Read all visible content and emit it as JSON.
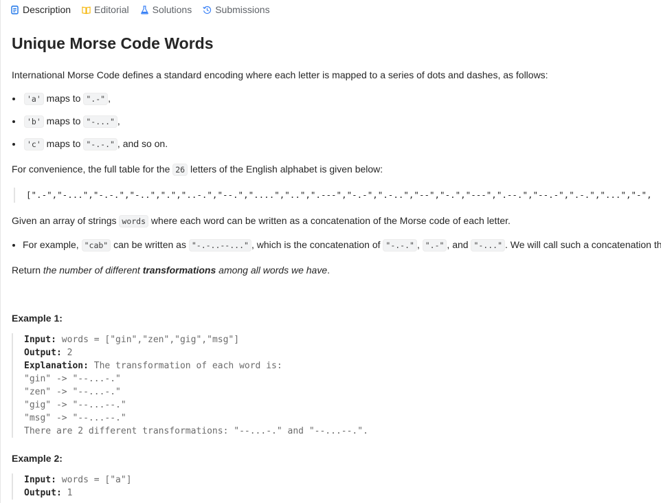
{
  "tabs": [
    {
      "label": "Description",
      "icon": "description-icon",
      "color": "#1a73e8"
    },
    {
      "label": "Editorial",
      "icon": "book-icon",
      "color": "#f5b400"
    },
    {
      "label": "Solutions",
      "icon": "flask-icon",
      "color": "#3b82f6"
    },
    {
      "label": "Submissions",
      "icon": "history-icon",
      "color": "#3b82f6"
    }
  ],
  "problem": {
    "title": "Unique Morse Code Words",
    "intro": "International Morse Code defines a standard encoding where each letter is mapped to a series of dots and dashes, as follows:",
    "mappings": [
      {
        "letter": "'a'",
        "mid": " maps to ",
        "code": "\".-\"",
        "tail": ","
      },
      {
        "letter": "'b'",
        "mid": " maps to ",
        "code": "\"-...\"",
        "tail": ","
      },
      {
        "letter": "'c'",
        "mid": " maps to ",
        "code": "\"-.-.\"",
        "tail": ", and so on."
      }
    ],
    "convenience_pre": "For convenience, the full table for the ",
    "convenience_num": "26",
    "convenience_post": " letters of the English alphabet is given below:",
    "table": "[\".-\",\"-...\",\"-.-.\",\"-..\",\".\",\"..-.\",\"--.\",\"....\",\"..\",\".---\",\"-.-\",\".-..\",\"--\",\"-.\",\"---\",\".--.\",\"--.-\",\".-.\",\"...\",\"-\",\"..-\",\"...-\",\".--\",\"-..-\",\"-.--\",\"--..\"]",
    "words_pre": "Given an array of strings ",
    "words_code": "words",
    "words_post": " where each word can be written as a concatenation of the Morse code of each letter.",
    "example_bullet": {
      "pre": "For example, ",
      "cab": "\"cab\"",
      "mid1": " can be written as ",
      "full": "\"-.-..--...\"",
      "mid2": ", which is the concatenation of ",
      "c": "\"-.-.\"",
      "comma1": ", ",
      "a": "\".-\"",
      "and": ", and ",
      "b": "\"-...\"",
      "post": ". We will call such a concatenation the transformation of a word."
    },
    "return_pre": "Return ",
    "return_em1": "the number of different ",
    "return_strong": "transformations",
    "return_em2": " among all words we have",
    "return_post": "."
  },
  "examples": [
    {
      "title": "Example 1:",
      "input_label": "Input:",
      "input_value": " words = [\"gin\",\"zen\",\"gig\",\"msg\"]",
      "output_label": "Output:",
      "output_value": " 2",
      "explanation_label": "Explanation:",
      "explanation_value": " The transformation of each word is:",
      "lines": [
        "\"gin\" -> \"--...-.\"",
        "\"zen\" -> \"--...-.\"",
        "\"gig\" -> \"--...--.\"",
        "\"msg\" -> \"--...--.\"",
        "There are 2 different transformations: \"--...-.\" and \"--...--.\"."
      ]
    },
    {
      "title": "Example 2:",
      "input_label": "Input:",
      "input_value": " words = [\"a\"]",
      "output_label": "Output:",
      "output_value": " 1"
    }
  ]
}
